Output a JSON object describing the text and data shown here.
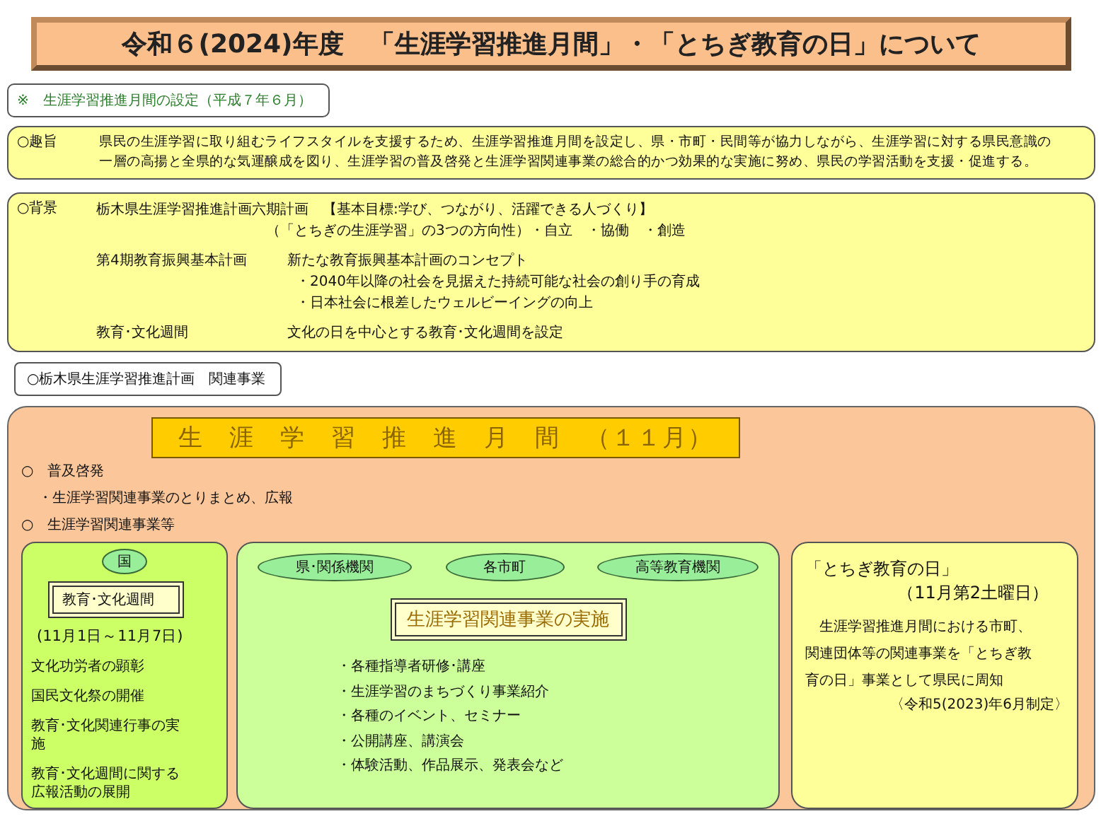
{
  "title": "令和６(2024)年度　「生涯学習推進月間」・「とちぎ教育の日」について",
  "note": "※　生涯学習推進月間の設定（平成７年６月）",
  "purpose": {
    "label": "○趣旨",
    "lines": [
      "県民の生涯学習に取り組むライフスタイルを支援するため、生涯学習推進月間を設定し、県・市町・民間等が協力しながら、生涯学習に対する県民意識の",
      "一層の高揚と全県的な気運醸成を図り、生涯学習の普及啓発と生涯学習関連事業の総合的かつ効果的な実施に努め、県民の学習活動を支援・促進する。"
    ]
  },
  "background": {
    "label": "○背景",
    "rows": [
      {
        "term": "栃木県生涯学習推進計画六期計画",
        "lines": [
          "【基本目標:学び、つながり、活躍できる人づくり】",
          "（「とちぎの生涯学習」の3つの方向性）・自立　・協働　・創造"
        ]
      },
      {
        "term": "第4期教育振興基本計画",
        "lines": [
          "新たな教育振興基本計画のコンセプト",
          "・2040年以降の社会を見据えた持続可能な社会の創り手の育成",
          "・日本社会に根差したウェルビーイングの向上"
        ]
      },
      {
        "term": "教育･文化週間",
        "lines": [
          "文化の日を中心とする教育･文化週間を設定"
        ]
      }
    ]
  },
  "related_label": "○栃木県生涯学習推進計画　関連事業",
  "month": {
    "heading": "生　涯　学　習　推　進　月　間　（１１月）",
    "items": [
      {
        "kind": "heading",
        "text": "○　普及啓発"
      },
      {
        "kind": "bullet",
        "text": "・生涯学習関連事業のとりまとめ、広報"
      },
      {
        "kind": "heading",
        "text": "○　生涯学習関連事業等"
      }
    ],
    "national": {
      "badge": "国",
      "heading": "教育･文化週間",
      "period": "(11月1日～11月7日)",
      "items": [
        "文化功労者の顕彰",
        "国民文化祭の開催",
        "教育･文化関連行事の実施",
        "教育･文化週間に関する広報活動の展開"
      ]
    },
    "local": {
      "agencies": [
        "県･関係機関",
        "各市町",
        "高等教育機関"
      ],
      "heading": "生涯学習関連事業の実施",
      "items": [
        "・各種指導者研修･講座",
        "・生涯学習のまちづくり事業紹介",
        "・各種のイベント、セミナー",
        "・公開講座、講演会",
        "・体験活動、作品展示、発表会など"
      ]
    },
    "tochigi_day": {
      "title": "「とちぎ教育の日」",
      "subtitle": "（11月第2土曜日）",
      "body": "生涯学習推進月間における市町、関連団体等の関連事業を「とちぎ教育の日」事業として県民に周知",
      "footnote": "〈令和5(2023)年6月制定〉"
    }
  }
}
